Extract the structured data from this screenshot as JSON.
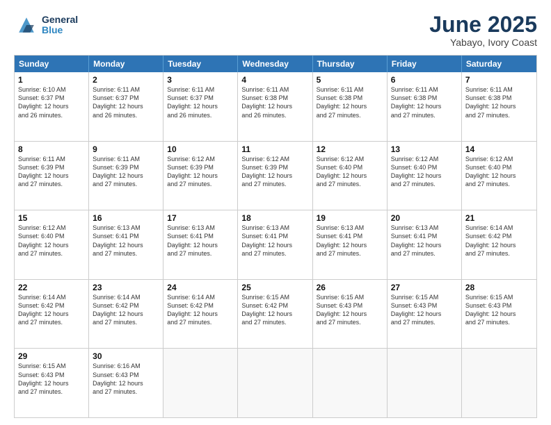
{
  "header": {
    "logo_general": "General",
    "logo_blue": "Blue",
    "title": "June 2025",
    "subtitle": "Yabayo, Ivory Coast"
  },
  "calendar": {
    "days_of_week": [
      "Sunday",
      "Monday",
      "Tuesday",
      "Wednesday",
      "Thursday",
      "Friday",
      "Saturday"
    ],
    "rows": [
      [
        {
          "day": "",
          "empty": true
        },
        {
          "day": "",
          "empty": true
        },
        {
          "day": "",
          "empty": true
        },
        {
          "day": "",
          "empty": true
        },
        {
          "day": "",
          "empty": true
        },
        {
          "day": "",
          "empty": true
        },
        {
          "day": "",
          "empty": true
        }
      ],
      [
        {
          "day": "1",
          "sunrise": "6:10 AM",
          "sunset": "6:37 PM",
          "daylight": "12 hours and 26 minutes."
        },
        {
          "day": "2",
          "sunrise": "6:11 AM",
          "sunset": "6:37 PM",
          "daylight": "12 hours and 26 minutes."
        },
        {
          "day": "3",
          "sunrise": "6:11 AM",
          "sunset": "6:37 PM",
          "daylight": "12 hours and 26 minutes."
        },
        {
          "day": "4",
          "sunrise": "6:11 AM",
          "sunset": "6:38 PM",
          "daylight": "12 hours and 26 minutes."
        },
        {
          "day": "5",
          "sunrise": "6:11 AM",
          "sunset": "6:38 PM",
          "daylight": "12 hours and 27 minutes."
        },
        {
          "day": "6",
          "sunrise": "6:11 AM",
          "sunset": "6:38 PM",
          "daylight": "12 hours and 27 minutes."
        },
        {
          "day": "7",
          "sunrise": "6:11 AM",
          "sunset": "6:38 PM",
          "daylight": "12 hours and 27 minutes."
        }
      ],
      [
        {
          "day": "8",
          "sunrise": "6:11 AM",
          "sunset": "6:39 PM",
          "daylight": "12 hours and 27 minutes."
        },
        {
          "day": "9",
          "sunrise": "6:11 AM",
          "sunset": "6:39 PM",
          "daylight": "12 hours and 27 minutes."
        },
        {
          "day": "10",
          "sunrise": "6:12 AM",
          "sunset": "6:39 PM",
          "daylight": "12 hours and 27 minutes."
        },
        {
          "day": "11",
          "sunrise": "6:12 AM",
          "sunset": "6:39 PM",
          "daylight": "12 hours and 27 minutes."
        },
        {
          "day": "12",
          "sunrise": "6:12 AM",
          "sunset": "6:40 PM",
          "daylight": "12 hours and 27 minutes."
        },
        {
          "day": "13",
          "sunrise": "6:12 AM",
          "sunset": "6:40 PM",
          "daylight": "12 hours and 27 minutes."
        },
        {
          "day": "14",
          "sunrise": "6:12 AM",
          "sunset": "6:40 PM",
          "daylight": "12 hours and 27 minutes."
        }
      ],
      [
        {
          "day": "15",
          "sunrise": "6:12 AM",
          "sunset": "6:40 PM",
          "daylight": "12 hours and 27 minutes."
        },
        {
          "day": "16",
          "sunrise": "6:13 AM",
          "sunset": "6:41 PM",
          "daylight": "12 hours and 27 minutes."
        },
        {
          "day": "17",
          "sunrise": "6:13 AM",
          "sunset": "6:41 PM",
          "daylight": "12 hours and 27 minutes."
        },
        {
          "day": "18",
          "sunrise": "6:13 AM",
          "sunset": "6:41 PM",
          "daylight": "12 hours and 27 minutes."
        },
        {
          "day": "19",
          "sunrise": "6:13 AM",
          "sunset": "6:41 PM",
          "daylight": "12 hours and 27 minutes."
        },
        {
          "day": "20",
          "sunrise": "6:13 AM",
          "sunset": "6:41 PM",
          "daylight": "12 hours and 27 minutes."
        },
        {
          "day": "21",
          "sunrise": "6:14 AM",
          "sunset": "6:42 PM",
          "daylight": "12 hours and 27 minutes."
        }
      ],
      [
        {
          "day": "22",
          "sunrise": "6:14 AM",
          "sunset": "6:42 PM",
          "daylight": "12 hours and 27 minutes."
        },
        {
          "day": "23",
          "sunrise": "6:14 AM",
          "sunset": "6:42 PM",
          "daylight": "12 hours and 27 minutes."
        },
        {
          "day": "24",
          "sunrise": "6:14 AM",
          "sunset": "6:42 PM",
          "daylight": "12 hours and 27 minutes."
        },
        {
          "day": "25",
          "sunrise": "6:15 AM",
          "sunset": "6:42 PM",
          "daylight": "12 hours and 27 minutes."
        },
        {
          "day": "26",
          "sunrise": "6:15 AM",
          "sunset": "6:43 PM",
          "daylight": "12 hours and 27 minutes."
        },
        {
          "day": "27",
          "sunrise": "6:15 AM",
          "sunset": "6:43 PM",
          "daylight": "12 hours and 27 minutes."
        },
        {
          "day": "28",
          "sunrise": "6:15 AM",
          "sunset": "6:43 PM",
          "daylight": "12 hours and 27 minutes."
        }
      ],
      [
        {
          "day": "29",
          "sunrise": "6:15 AM",
          "sunset": "6:43 PM",
          "daylight": "12 hours and 27 minutes."
        },
        {
          "day": "30",
          "sunrise": "6:16 AM",
          "sunset": "6:43 PM",
          "daylight": "12 hours and 27 minutes."
        },
        {
          "day": "",
          "empty": true
        },
        {
          "day": "",
          "empty": true
        },
        {
          "day": "",
          "empty": true
        },
        {
          "day": "",
          "empty": true
        },
        {
          "day": "",
          "empty": true
        }
      ]
    ]
  }
}
